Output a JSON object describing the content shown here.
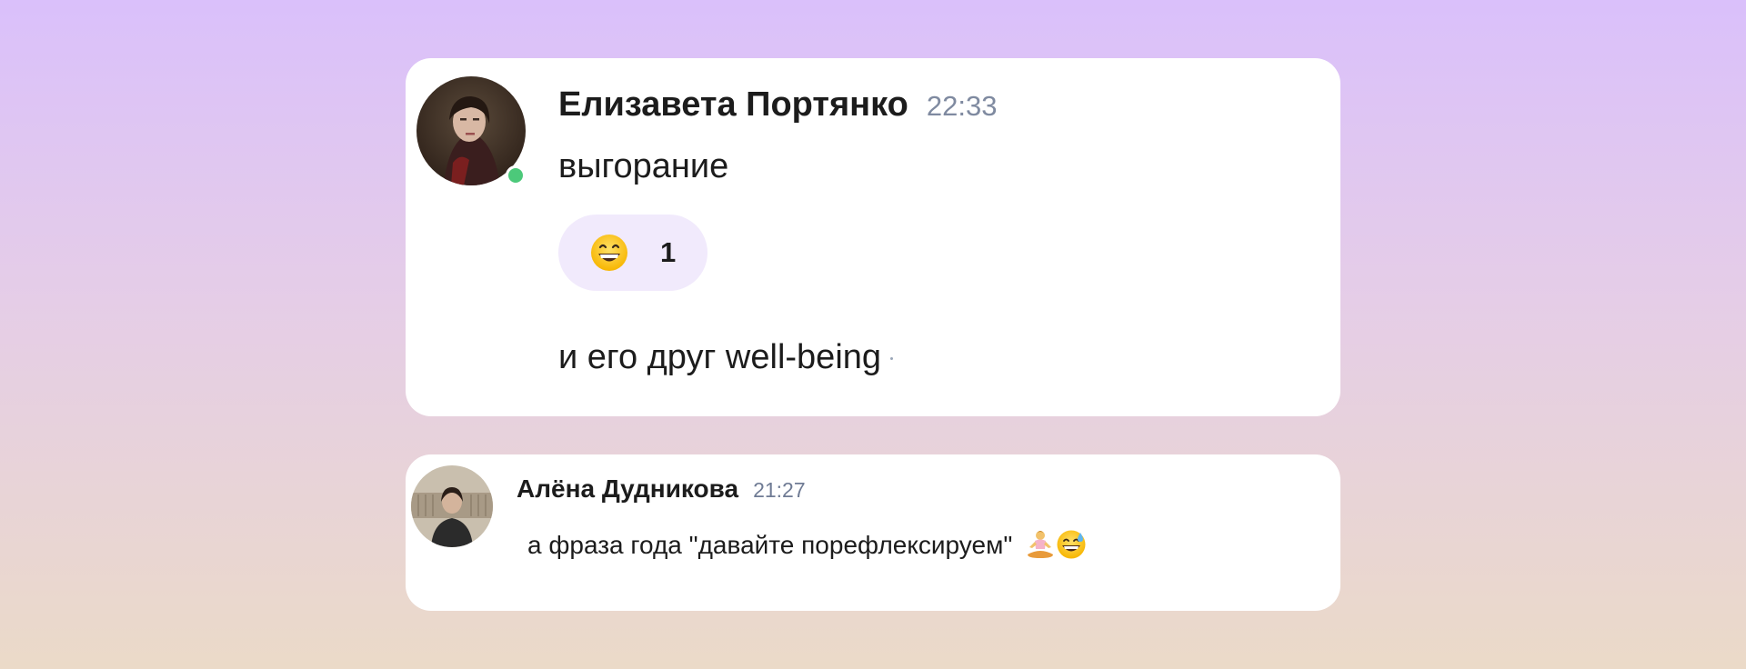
{
  "messages": [
    {
      "author": "Елизавета Портянко",
      "time": "22:33",
      "text": "выгорание",
      "online": true,
      "reaction": {
        "emoji": "grinning-face-with-smiling-eyes",
        "count": "1"
      },
      "followup_text": "и его друг well-being"
    },
    {
      "author": "Алёна Дудникова",
      "time": "21:27",
      "text": "а фраза года \"давайте порефлексируем\"",
      "trailing_emojis": [
        "person-in-lotus-position",
        "grinning-face-with-sweat"
      ]
    }
  ],
  "colors": {
    "online": "#4cc97a",
    "reaction_bg": "#f1eafc",
    "timestamp": "#7f8aa0"
  }
}
